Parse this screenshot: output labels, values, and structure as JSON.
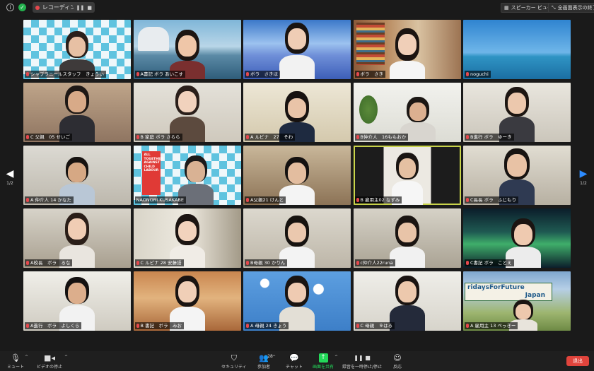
{
  "topbar": {
    "recording_label": "レコーディング...",
    "speaker_view": "スピーカー ビュー",
    "exit_fullscreen": "全画面表示の終了"
  },
  "pagination": {
    "left_page": "1/2",
    "right_page": "1/2"
  },
  "participants": [
    {
      "name": "シャプラニールスタッフ　きょうい",
      "muted": true
    },
    {
      "name": "A書記 ボラ あいこす",
      "muted": true
    },
    {
      "name": "ボラ　さきほ",
      "muted": true
    },
    {
      "name": "ボラ　さき",
      "muted": true
    },
    {
      "name": "noguchi",
      "muted": true
    },
    {
      "name": "C 父親　05 せいご",
      "muted": true
    },
    {
      "name": "B 家庭 ボラ さらら",
      "muted": true
    },
    {
      "name": "A ルビナ　27　そわ",
      "muted": true
    },
    {
      "name": "B仲介人　16ももおか",
      "muted": true
    },
    {
      "name": "B進行 ボラ　ゆーき",
      "muted": true
    },
    {
      "name": "A 仲介人 14 かなた",
      "muted": true
    },
    {
      "name": "NAONORI KUSAKABE",
      "muted": false
    },
    {
      "name": "A父親21 けんと",
      "muted": true
    },
    {
      "name": "B 雇用主02 なずみ",
      "muted": true
    },
    {
      "name": "C長長 ボラ　ふじもり",
      "muted": true
    },
    {
      "name": "A校長　ボラ　るな",
      "muted": true
    },
    {
      "name": "C ルビナ 28 安藤語",
      "muted": true
    },
    {
      "name": "B母親 30 かりん",
      "muted": true
    },
    {
      "name": "c仲介人22runa",
      "muted": true
    },
    {
      "name": "C書記 ボラ　ことえ",
      "muted": true
    },
    {
      "name": "A進行　ボラ　よしくら",
      "muted": true
    },
    {
      "name": "B 書記　ボラ　みお",
      "muted": true
    },
    {
      "name": "A 母親 24 きょう",
      "muted": true
    },
    {
      "name": "C 母親　９はる",
      "muted": true
    },
    {
      "name": "A 雇用主 13 ぺっきー",
      "muted": true
    }
  ],
  "sign_text": {
    "fff_line1": "ridaysForFuture",
    "fff_line2": "Japan",
    "banner_line1": "ALL",
    "banner_line2": "TOGETHER",
    "banner_line3": "AGAINST",
    "banner_line4": "CHILD",
    "banner_line5": "LABOUR"
  },
  "toolbar": {
    "mute": "ミュート",
    "video_stop": "ビデオの停止",
    "security": "セキュリティ",
    "participants": "参加者",
    "participant_count": "28",
    "chat": "チャット",
    "share_screen": "画面を共有",
    "pause_recording": "録音を一時停止/停止",
    "reactions": "反応",
    "end": "退出"
  },
  "colors": {
    "muted_mic": "#e5484d",
    "active_speaker": "#c8d34a",
    "share_green": "#23d959",
    "end_red": "#e0443c"
  }
}
